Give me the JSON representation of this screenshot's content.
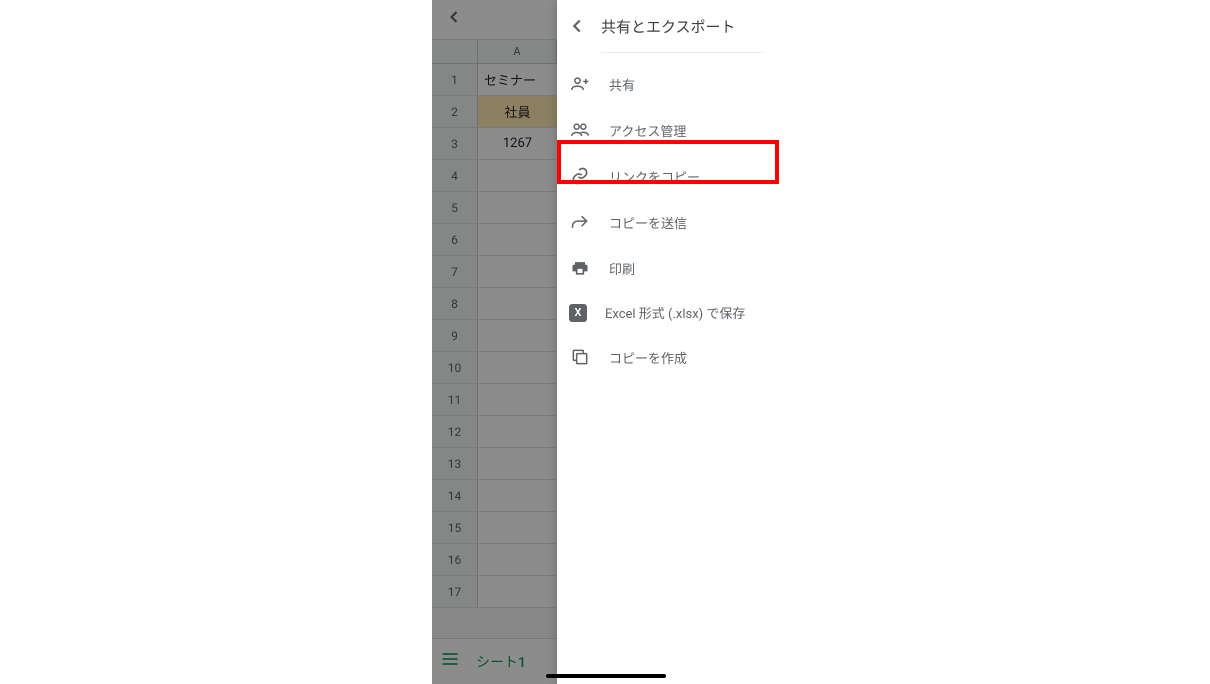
{
  "spreadsheet": {
    "column_header": "A",
    "rows": [
      {
        "num": "1",
        "value": "セミナー"
      },
      {
        "num": "2",
        "value": "社員",
        "style": "header"
      },
      {
        "num": "3",
        "value": "1267",
        "style": "data"
      },
      {
        "num": "4",
        "value": ""
      },
      {
        "num": "5",
        "value": ""
      },
      {
        "num": "6",
        "value": ""
      },
      {
        "num": "7",
        "value": ""
      },
      {
        "num": "8",
        "value": ""
      },
      {
        "num": "9",
        "value": ""
      },
      {
        "num": "10",
        "value": ""
      },
      {
        "num": "11",
        "value": ""
      },
      {
        "num": "12",
        "value": ""
      },
      {
        "num": "13",
        "value": ""
      },
      {
        "num": "14",
        "value": ""
      },
      {
        "num": "15",
        "value": ""
      },
      {
        "num": "16",
        "value": ""
      },
      {
        "num": "17",
        "value": ""
      }
    ],
    "tab_name": "シート1"
  },
  "panel": {
    "title": "共有とエクスポート",
    "items": [
      {
        "icon": "person-add",
        "label": "共有"
      },
      {
        "icon": "people",
        "label": "アクセス管理"
      },
      {
        "icon": "link",
        "label": "リンクをコピー"
      },
      {
        "icon": "send",
        "label": "コピーを送信"
      },
      {
        "icon": "print",
        "label": "印刷"
      },
      {
        "icon": "excel",
        "label": "Excel 形式 (.xlsx) で保存"
      },
      {
        "icon": "copy",
        "label": "コピーを作成"
      }
    ]
  }
}
